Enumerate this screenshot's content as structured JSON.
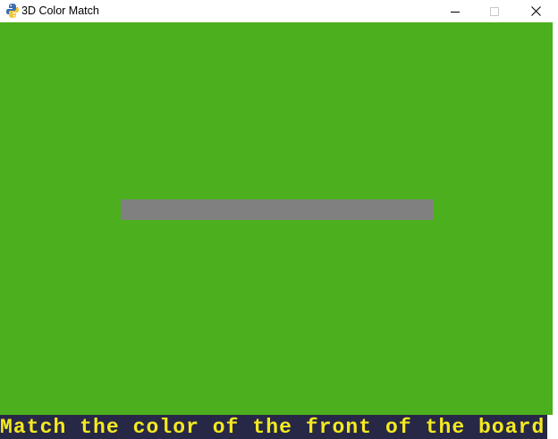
{
  "window": {
    "title": "3D Color Match",
    "app_icon": "python-icon",
    "controls": {
      "minimize_icon": "minimize-icon",
      "maximize_icon": "maximize-icon",
      "close_icon": "close-icon"
    }
  },
  "game": {
    "background_color": "#4caf1d",
    "board_front_color": "#808080",
    "status_message": "Match the color of the front of the board",
    "status_text_color": "#f4ea21",
    "status_bg_color": "#272845"
  }
}
